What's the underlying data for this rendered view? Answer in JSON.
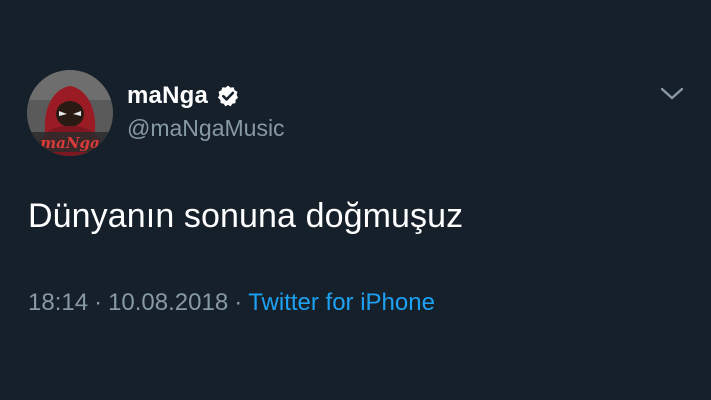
{
  "user": {
    "display_name": "maNga",
    "handle": "@maNgaMusic",
    "avatar_logo_text": "maNga",
    "verified": true
  },
  "tweet": {
    "text": "Dünyanın sonuna doğmuşuz",
    "time": "18:14",
    "date": "10.08.2018",
    "separator": "·",
    "source": "Twitter for iPhone"
  },
  "icons": {
    "verified": "verified-badge-icon",
    "menu": "chevron-down-icon"
  },
  "colors": {
    "background": "#15202b",
    "secondary_text": "#8899a6",
    "link": "#1da1f2",
    "avatar_accent": "#b01f2a"
  }
}
